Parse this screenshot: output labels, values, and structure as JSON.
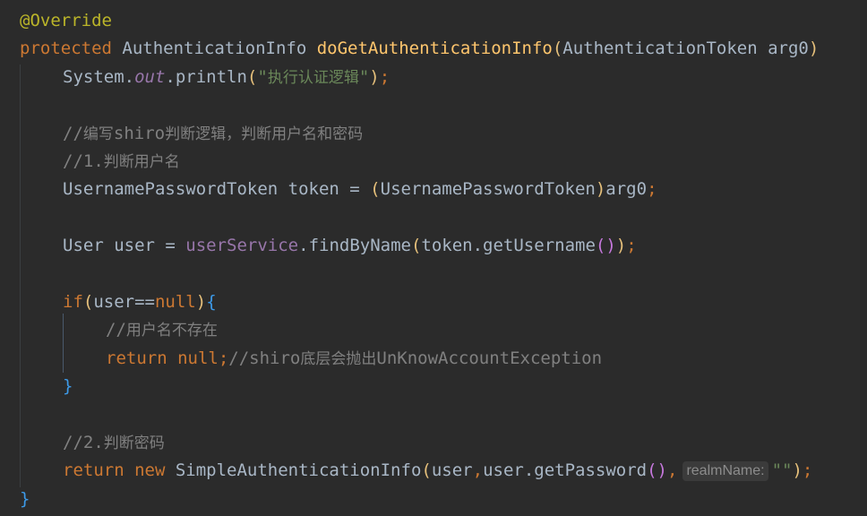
{
  "editor": {
    "language": "Java",
    "lines": [
      {
        "tokens": [
          {
            "t": "@Override",
            "c": "annotation"
          }
        ]
      },
      {
        "tokens": [
          {
            "t": "protected",
            "c": "keyword"
          },
          {
            "t": " AuthenticationInfo ",
            "c": "type"
          },
          {
            "t": "doGetAuthenticationInfo",
            "c": "method-decl"
          },
          {
            "t": "(",
            "c": "paren-1"
          },
          {
            "t": "AuthenticationToken arg0",
            "c": "plain"
          },
          {
            "t": ")",
            "c": "paren-1"
          }
        ]
      },
      {
        "tokens": [
          {
            "t": "System.",
            "c": "plain"
          },
          {
            "t": "out",
            "c": "static-field"
          },
          {
            "t": ".println",
            "c": "plain"
          },
          {
            "t": "(",
            "c": "paren-1"
          },
          {
            "t": "\"",
            "c": "string"
          },
          {
            "t": "执行认证逻辑",
            "c": "string-cjk"
          },
          {
            "t": "\"",
            "c": "string"
          },
          {
            "t": ")",
            "c": "paren-1"
          },
          {
            "t": ";",
            "c": "punct"
          }
        ]
      },
      {
        "tokens": []
      },
      {
        "tokens": [
          {
            "t": "//",
            "c": "comment"
          },
          {
            "t": "编写",
            "c": "comment-cjk"
          },
          {
            "t": "shiro",
            "c": "comment"
          },
          {
            "t": "判断逻辑，判断用户名和密码",
            "c": "comment-cjk"
          }
        ]
      },
      {
        "tokens": [
          {
            "t": "//1.",
            "c": "comment"
          },
          {
            "t": "判断用户名",
            "c": "comment-cjk"
          }
        ]
      },
      {
        "tokens": [
          {
            "t": "UsernamePasswordToken token = ",
            "c": "plain"
          },
          {
            "t": "(",
            "c": "paren-1"
          },
          {
            "t": "UsernamePasswordToken",
            "c": "plain"
          },
          {
            "t": ")",
            "c": "paren-1"
          },
          {
            "t": "arg0",
            "c": "plain"
          },
          {
            "t": ";",
            "c": "punct"
          }
        ]
      },
      {
        "tokens": []
      },
      {
        "tokens": [
          {
            "t": "User user = ",
            "c": "plain"
          },
          {
            "t": "userService",
            "c": "field"
          },
          {
            "t": ".findByName",
            "c": "plain"
          },
          {
            "t": "(",
            "c": "paren-1"
          },
          {
            "t": "token.getUsername",
            "c": "plain"
          },
          {
            "t": "()",
            "c": "paren-2"
          },
          {
            "t": ")",
            "c": "paren-1"
          },
          {
            "t": ";",
            "c": "punct"
          }
        ]
      },
      {
        "tokens": []
      },
      {
        "tokens": [
          {
            "t": "if",
            "c": "keyword"
          },
          {
            "t": "(",
            "c": "paren-1"
          },
          {
            "t": "user==",
            "c": "plain"
          },
          {
            "t": "null",
            "c": "keyword"
          },
          {
            "t": ")",
            "c": "paren-1"
          },
          {
            "t": "{",
            "c": "brace"
          }
        ]
      },
      {
        "tokens": [
          {
            "t": "//",
            "c": "comment"
          },
          {
            "t": "用户名不存在",
            "c": "comment-cjk"
          }
        ]
      },
      {
        "tokens": [
          {
            "t": "return ",
            "c": "keyword"
          },
          {
            "t": "null",
            "c": "keyword"
          },
          {
            "t": ";",
            "c": "punct"
          },
          {
            "t": "//shiro",
            "c": "comment"
          },
          {
            "t": "底层会抛出",
            "c": "comment-cjk"
          },
          {
            "t": "UnKnowAccountException",
            "c": "comment"
          }
        ]
      },
      {
        "tokens": [
          {
            "t": "}",
            "c": "brace"
          }
        ]
      },
      {
        "tokens": []
      },
      {
        "tokens": [
          {
            "t": "//2.",
            "c": "comment"
          },
          {
            "t": "判断密码",
            "c": "comment-cjk"
          }
        ]
      },
      {
        "tokens": [
          {
            "t": "return ",
            "c": "keyword"
          },
          {
            "t": "new ",
            "c": "keyword"
          },
          {
            "t": "SimpleAuthenticationInfo",
            "c": "plain"
          },
          {
            "t": "(",
            "c": "paren-1"
          },
          {
            "t": "user",
            "c": "plain"
          },
          {
            "t": ",",
            "c": "punct"
          },
          {
            "t": "user.getPassword",
            "c": "plain"
          },
          {
            "t": "()",
            "c": "paren-2"
          },
          {
            "t": ",",
            "c": "punct"
          },
          {
            "t": "realmName:",
            "c": "hint"
          },
          {
            "t": "\"\"",
            "c": "string"
          },
          {
            "t": ")",
            "c": "paren-1"
          },
          {
            "t": ";",
            "c": "punct"
          }
        ]
      },
      {
        "tokens": [
          {
            "t": "}",
            "c": "brace"
          }
        ]
      }
    ]
  },
  "colors": {
    "background": "#2b2b2b",
    "keyword": "#cc7832",
    "annotation": "#bbb529",
    "method_declaration": "#ffc66d",
    "string": "#6a8759",
    "comment": "#808080",
    "field": "#9876aa",
    "default_text": "#a9b7c6"
  }
}
